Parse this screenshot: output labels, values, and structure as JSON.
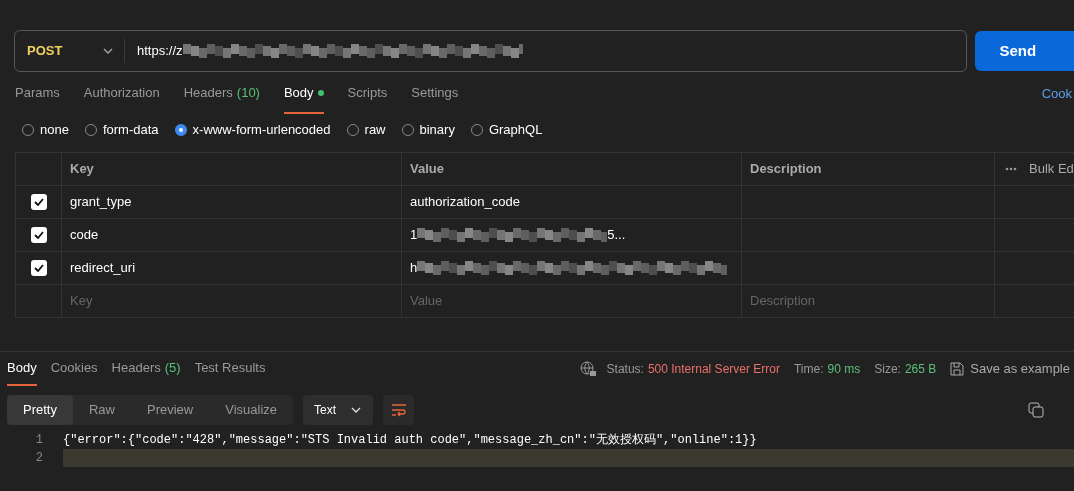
{
  "request": {
    "method": "POST",
    "url": "https://z",
    "url_redacted": true,
    "send": "Send"
  },
  "request_tabs": [
    {
      "label": "Params",
      "selected": false
    },
    {
      "label": "Authorization",
      "selected": false
    },
    {
      "label": "Headers",
      "count": "(10)",
      "selected": false
    },
    {
      "label": "Body",
      "selected": true,
      "dot": true
    },
    {
      "label": "Scripts",
      "selected": false
    },
    {
      "label": "Settings",
      "selected": false
    }
  ],
  "cookies_link": "Cook",
  "body_types": [
    {
      "label": "none",
      "selected": false
    },
    {
      "label": "form-data",
      "selected": false
    },
    {
      "label": "x-www-form-urlencoded",
      "selected": true
    },
    {
      "label": "raw",
      "selected": false
    },
    {
      "label": "binary",
      "selected": false
    },
    {
      "label": "GraphQL",
      "selected": false
    }
  ],
  "table": {
    "columns": [
      "Key",
      "Value",
      "Description"
    ],
    "bulk_edit": "Bulk Ed",
    "rows": [
      {
        "checked": true,
        "key": "grant_type",
        "value": "authorization_code",
        "redacted": false
      },
      {
        "checked": true,
        "key": "code",
        "value": "1",
        "value_end": "5...",
        "redacted": true
      },
      {
        "checked": true,
        "key": "redirect_uri",
        "value": "h",
        "redacted": true
      }
    ],
    "placeholder_row": {
      "key": "Key",
      "value": "Value",
      "description": "Description"
    }
  },
  "response_tabs": [
    {
      "label": "Body",
      "selected": true
    },
    {
      "label": "Cookies",
      "selected": false
    },
    {
      "label": "Headers",
      "count": "(5)",
      "selected": false
    },
    {
      "label": "Test Results",
      "selected": false
    }
  ],
  "status": {
    "status_label": "Status:",
    "status": "500 Internal Server Error",
    "time_label": "Time:",
    "time": "90 ms",
    "size_label": "Size:",
    "size": "265 B",
    "save_example": "Save as example"
  },
  "view_modes": [
    {
      "label": "Pretty",
      "selected": true
    },
    {
      "label": "Raw",
      "selected": false
    },
    {
      "label": "Preview",
      "selected": false
    },
    {
      "label": "Visualize",
      "selected": false
    }
  ],
  "format": "Text",
  "code_lines": [
    {
      "number": "1",
      "text": "{\"error\":{\"code\":\"428\",\"message\":\"STS Invalid auth code\",\"message_zh_cn\":\"无效授权码\",\"online\":1}}",
      "highlighted": false
    },
    {
      "number": "2",
      "highlighted": true
    }
  ]
}
